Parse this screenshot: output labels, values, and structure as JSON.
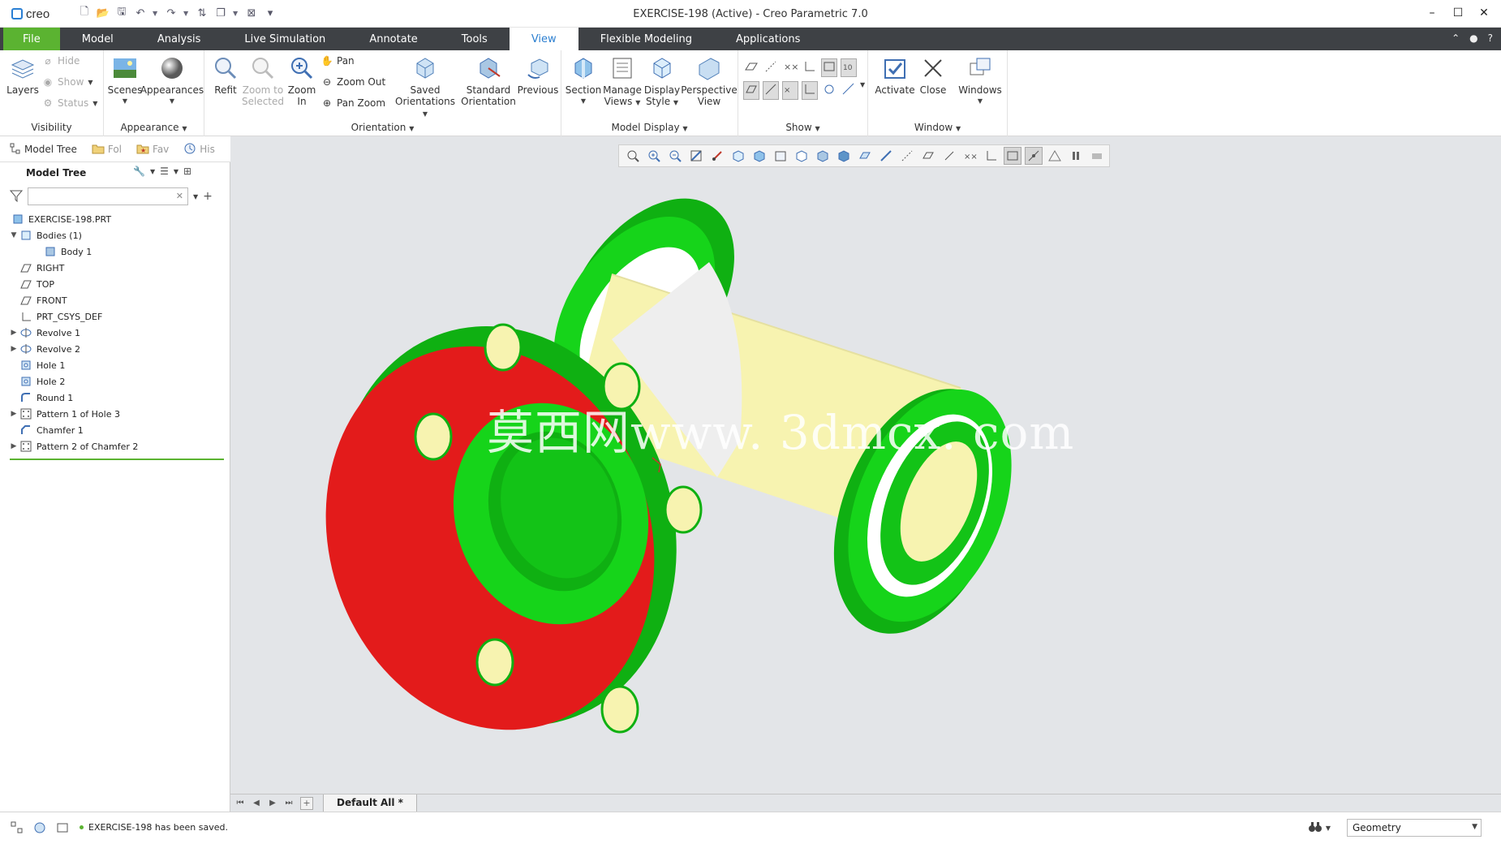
{
  "app": {
    "logo_text": "creo",
    "window_title": "EXERCISE-198 (Active) - Creo Parametric 7.0",
    "window_buttons": [
      "minimize-icon",
      "maximize-icon",
      "close-icon"
    ]
  },
  "ribbon_tabs": [
    {
      "label": "File"
    },
    {
      "label": "Model"
    },
    {
      "label": "Analysis"
    },
    {
      "label": "Live Simulation"
    },
    {
      "label": "Annotate"
    },
    {
      "label": "Tools"
    },
    {
      "label": "View",
      "active": true
    },
    {
      "label": "Flexible Modeling"
    },
    {
      "label": "Applications"
    }
  ],
  "ribbon": {
    "visibility": {
      "group_label": "Visibility",
      "layers": "Layers",
      "hide": "Hide",
      "show": "Show",
      "status": "Status"
    },
    "appearance": {
      "group_label": "Appearance",
      "scenes": "Scenes",
      "appearances": "Appearances"
    },
    "orientation": {
      "group_label": "Orientation",
      "refit": "Refit",
      "zoom_to_selected_1": "Zoom to",
      "zoom_to_selected_2": "Selected",
      "zoom_in_1": "Zoom",
      "zoom_in_2": "In",
      "pan": "Pan",
      "zoom_out": "Zoom Out",
      "pan_zoom": "Pan Zoom",
      "saved_orient_1": "Saved",
      "saved_orient_2": "Orientations",
      "standard_orient_1": "Standard",
      "standard_orient_2": "Orientation",
      "previous": "Previous"
    },
    "model_display": {
      "group_label": "Model Display",
      "section": "Section",
      "manage_views_1": "Manage",
      "manage_views_2": "Views",
      "display_style_1": "Display",
      "display_style_2": "Style",
      "perspective_1": "Perspective",
      "perspective_2": "View"
    },
    "show": {
      "group_label": "Show"
    },
    "window": {
      "group_label": "Window",
      "activate": "Activate",
      "close": "Close",
      "windows": "Windows"
    }
  },
  "nav_tabs": [
    {
      "label": "Model Tree"
    },
    {
      "label": "Fol"
    },
    {
      "label": "Fav"
    },
    {
      "label": "His"
    }
  ],
  "model_tree": {
    "title": "Model Tree",
    "filter_placeholder": "",
    "items": [
      {
        "label": "EXERCISE-198.PRT",
        "icon": "part-icon",
        "level": 0,
        "expander": ""
      },
      {
        "label": "Bodies (1)",
        "icon": "bodies-icon",
        "level": 1,
        "expander": "▼"
      },
      {
        "label": "Body 1",
        "icon": "body-icon",
        "level": 2,
        "expander": ""
      },
      {
        "label": "RIGHT",
        "icon": "datum-plane-icon",
        "level": 1,
        "expander": ""
      },
      {
        "label": "TOP",
        "icon": "datum-plane-icon",
        "level": 1,
        "expander": ""
      },
      {
        "label": "FRONT",
        "icon": "datum-plane-icon",
        "level": 1,
        "expander": ""
      },
      {
        "label": "PRT_CSYS_DEF",
        "icon": "csys-icon",
        "level": 1,
        "expander": ""
      },
      {
        "label": "Revolve 1",
        "icon": "revolve-icon",
        "level": 1,
        "expander": "▶"
      },
      {
        "label": "Revolve 2",
        "icon": "revolve-icon",
        "level": 1,
        "expander": "▶"
      },
      {
        "label": "Hole 1",
        "icon": "hole-icon",
        "level": 1,
        "expander": ""
      },
      {
        "label": "Hole 2",
        "icon": "hole-icon",
        "level": 1,
        "expander": ""
      },
      {
        "label": "Round 1",
        "icon": "round-icon",
        "level": 1,
        "expander": ""
      },
      {
        "label": "Pattern 1 of Hole 3",
        "icon": "pattern-icon",
        "level": 1,
        "expander": "▶"
      },
      {
        "label": "Chamfer 1",
        "icon": "chamfer-icon",
        "level": 1,
        "expander": ""
      },
      {
        "label": "Pattern 2 of Chamfer 2",
        "icon": "pattern-icon",
        "level": 1,
        "expander": "▶"
      }
    ]
  },
  "graphics": {
    "watermark": "莫西网www. 3dmcx. com",
    "colors": {
      "flange_red": "#e31b1b",
      "flange_green": "#16d41a",
      "body_yellow": "#f7f3b0",
      "cut_white": "#eeeeee",
      "background": "#e3e5e8"
    }
  },
  "sheet_tab": "Default All *",
  "status": {
    "message": "EXERCISE-198 has been saved.",
    "selection_filter": "Geometry"
  }
}
